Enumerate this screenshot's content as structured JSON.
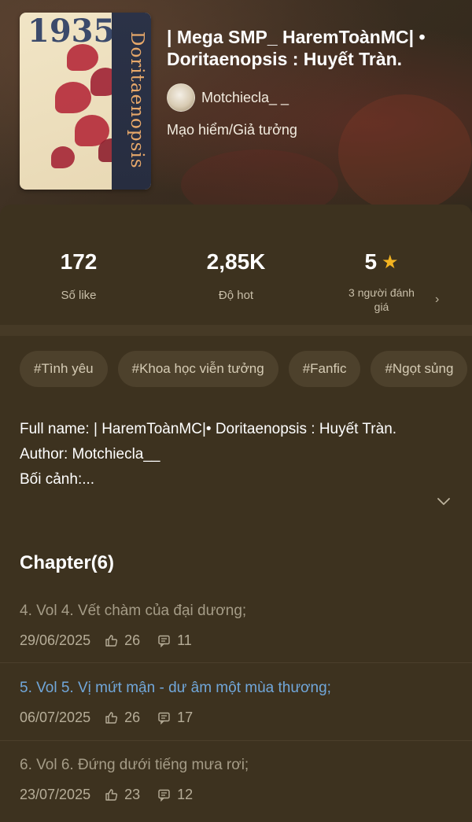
{
  "story": {
    "title": "| Mega SMP_ HaremToànMC| • Doritaenopsis : Huyết Tràn.",
    "author": "Motchiecla_ _",
    "genre": "Mạo hiểm/Giả tưởng",
    "cover": {
      "title_text": "Doritaenopsis",
      "year_text": "1935",
      "accent_color": "#b52a3a"
    }
  },
  "stats": {
    "likes": {
      "value": "172",
      "label": "Số like"
    },
    "hot": {
      "value": "2,85K",
      "label": "Độ hot"
    },
    "rating": {
      "value": "5",
      "label": "3 người đánh giá",
      "icon": "star-icon"
    }
  },
  "tags": [
    "#Tình yêu",
    "#Khoa học viễn tưởng",
    "#Fanfic",
    "#Ngọt sủng"
  ],
  "description": {
    "lines": [
      "Full name: | HaremToànMC|• Doritaenopsis : Huyết Tràn.",
      "Author: Motchiecla__",
      "Bối cảnh:..."
    ]
  },
  "chapters": {
    "heading": "Chapter(6)",
    "items": [
      {
        "title": "4. Vol 4. Vết chàm của đại dương;",
        "date": "29/06/2025",
        "likes": "26",
        "comments": "11",
        "active": false
      },
      {
        "title": "5. Vol 5. Vị mứt mận - dư âm một mùa thương;",
        "date": "06/07/2025",
        "likes": "26",
        "comments": "17",
        "active": true
      },
      {
        "title": "6. Vol 6. Đứng dưới tiếng mưa rơi;",
        "date": "23/07/2025",
        "likes": "23",
        "comments": "12",
        "active": false
      }
    ]
  },
  "colors": {
    "background": "#3b301d",
    "active_link": "#71a7da",
    "star": "#f2b321"
  }
}
